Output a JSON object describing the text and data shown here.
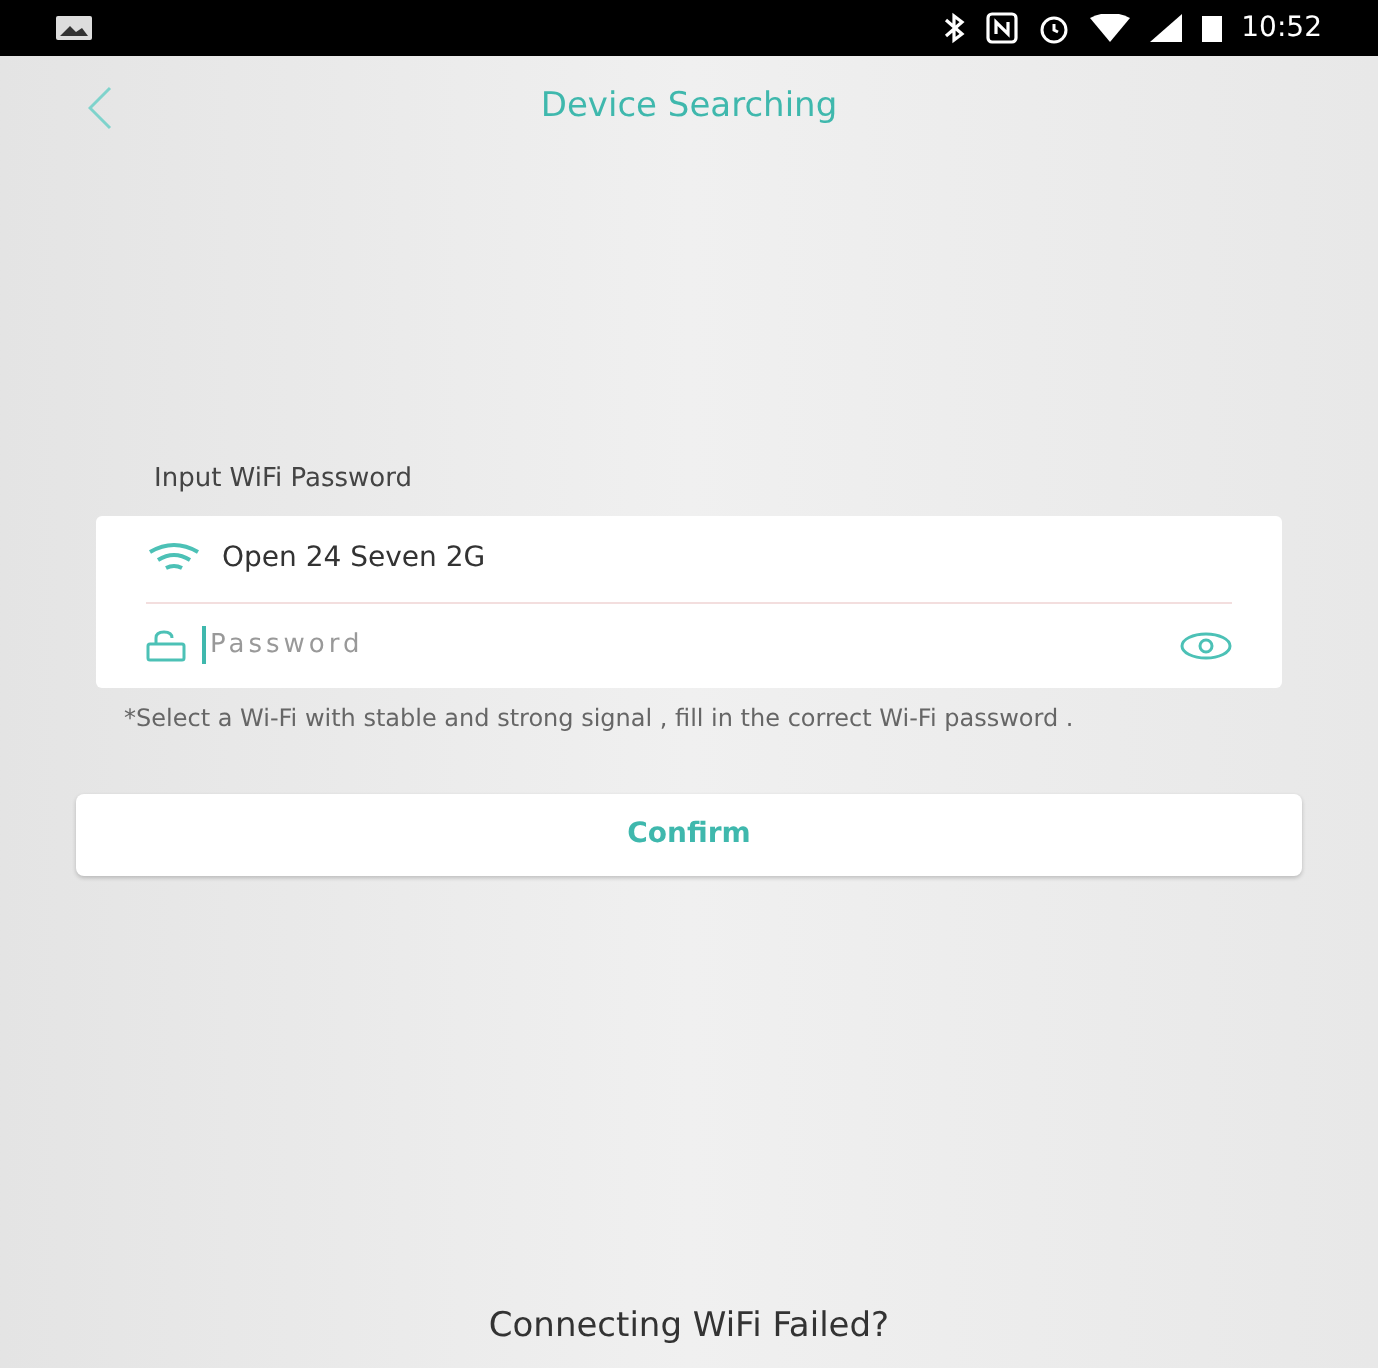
{
  "status_bar": {
    "time": "10:52"
  },
  "header": {
    "title": "Device Searching"
  },
  "form": {
    "label": "Input WiFi Password",
    "network": "Open 24 Seven 2G",
    "password": {
      "placeholder": "Password"
    },
    "note": "*Select a Wi-Fi with stable and strong signal , fill in the correct Wi-Fi password .",
    "confirm": "Confirm"
  },
  "footer_link": "Connecting WiFi Failed?"
}
